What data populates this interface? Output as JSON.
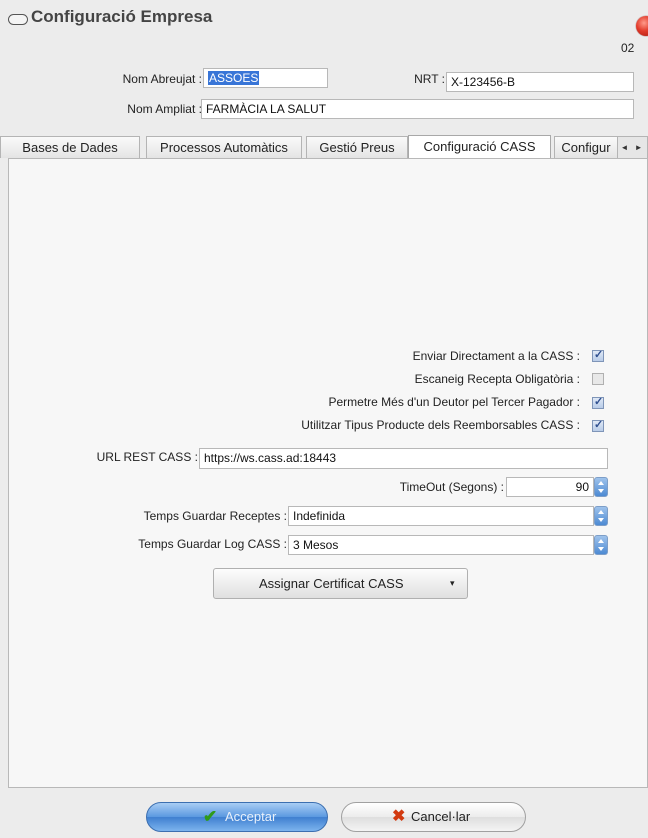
{
  "window": {
    "title": "Configuració Empresa",
    "code": "02"
  },
  "header": {
    "nom_abreujat_label": "Nom Abreujat :",
    "nom_abreujat_value": "ASSOES",
    "nrt_label": "NRT :",
    "nrt_value": "X-123456-B",
    "nom_ampliat_label": "Nom Ampliat :",
    "nom_ampliat_value": "FARMÀCIA  LA SALUT"
  },
  "tabs": [
    {
      "label": "Bases de Dades"
    },
    {
      "label": "Processos Automàtics"
    },
    {
      "label": "Gestió Preus"
    },
    {
      "label": "Configuració CASS"
    },
    {
      "label": "Configur"
    }
  ],
  "tab_scroll": "◄ ►",
  "cass": {
    "checks": [
      {
        "label": "Enviar Directament a la CASS :",
        "checked": true
      },
      {
        "label": "Escaneig Recepta Obligatòria :",
        "checked": false
      },
      {
        "label": "Permetre Més d'un Deutor pel Tercer Pagador :",
        "checked": true
      },
      {
        "label": "Utilitzar Tipus Producte dels Reemborsables CASS :",
        "checked": true
      }
    ],
    "url_label": "URL REST CASS :",
    "url_value": "https://ws.cass.ad:18443",
    "timeout_label": "TimeOut (Segons) :",
    "timeout_value": "90",
    "temps_receptes_label": "Temps Guardar Receptes :",
    "temps_receptes_value": "Indefinida",
    "temps_log_label": "Temps Guardar Log CASS :",
    "temps_log_value": "3 Mesos",
    "assign_label": "Assignar Certificat CASS",
    "assign_caret": "▾"
  },
  "footer": {
    "accept_label": "Acceptar",
    "cancel_label": "Cancel·lar"
  },
  "colors": {
    "selection": "#3875d7",
    "accept_button": "#4f8fdc",
    "check_mark": "#2f4f8f",
    "close_button": "#e23a2a"
  }
}
